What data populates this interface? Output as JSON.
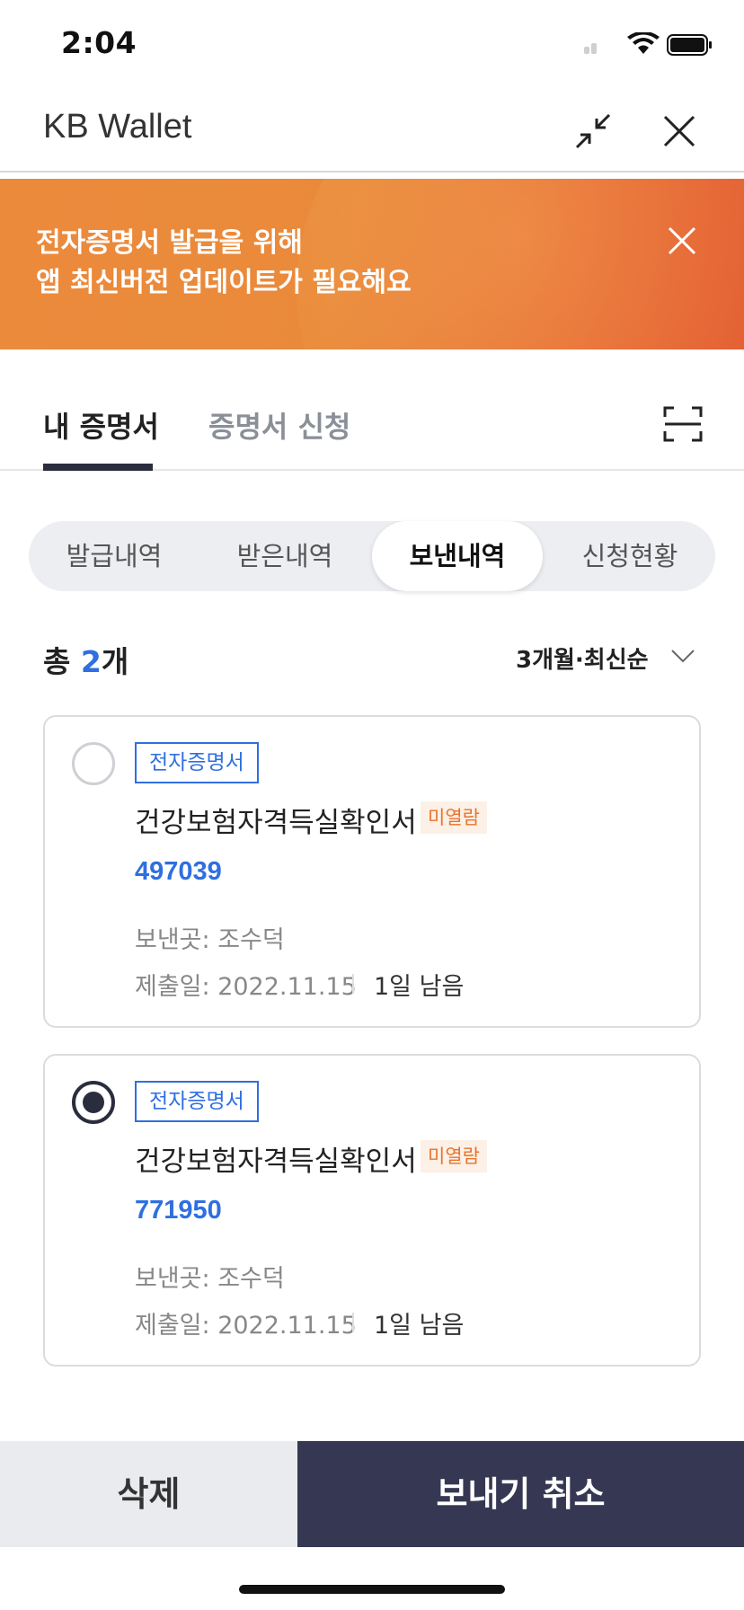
{
  "status_bar": {
    "time": "2:04"
  },
  "header": {
    "title": "KB Wallet"
  },
  "banner": {
    "line1": "전자증명서 발급을 위해",
    "line2": "앱 최신버전 업데이트가 필요해요"
  },
  "tabs": [
    {
      "label": "내 증명서",
      "active": true
    },
    {
      "label": "증명서 신청",
      "active": false
    }
  ],
  "segments": [
    {
      "label": "발급내역",
      "active": false
    },
    {
      "label": "받은내역",
      "active": false
    },
    {
      "label": "보낸내역",
      "active": true
    },
    {
      "label": "신청현황",
      "active": false
    }
  ],
  "summary": {
    "prefix": "총 ",
    "count": "2",
    "suffix": "개",
    "sort": "3개월·최신순"
  },
  "cards": [
    {
      "selected": false,
      "badge": "전자증명서",
      "name": "건강보험자격득실확인서",
      "status": "미열람",
      "number": "497039",
      "recipient": "보낸곳: 조수덕",
      "submit_date": "제출일: 2022.11.15",
      "remaining": "1일 남음"
    },
    {
      "selected": true,
      "badge": "전자증명서",
      "name": "건강보험자격득실확인서",
      "status": "미열람",
      "number": "771950",
      "recipient": "보낸곳: 조수덕",
      "submit_date": "제출일: 2022.11.15",
      "remaining": "1일 남음"
    }
  ],
  "actions": {
    "delete_label": "삭제",
    "cancel_label": "보내기 취소"
  },
  "colors": {
    "accent": "#2f6fe0",
    "primary_dark": "#363853",
    "banner": "#e98a3a",
    "unread": "#e8742e"
  }
}
